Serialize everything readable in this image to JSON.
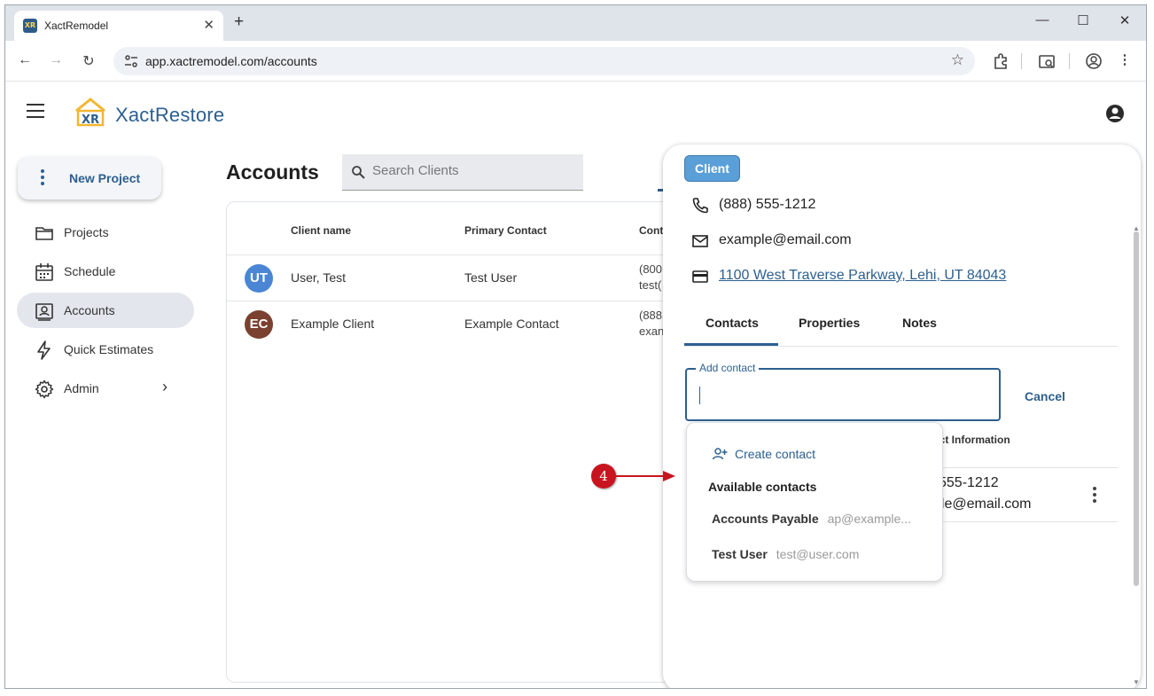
{
  "browser": {
    "tab_title": "XactRemodel",
    "favicon_text": "XR",
    "url": "app.xactremodel.com/accounts"
  },
  "header": {
    "brand": "XactRestore",
    "logo_text": "XR"
  },
  "sidebar": {
    "new_project": "New Project",
    "items": [
      {
        "label": "Projects",
        "icon": "folder-icon"
      },
      {
        "label": "Schedule",
        "icon": "calendar-icon"
      },
      {
        "label": "Accounts",
        "icon": "accounts-icon",
        "active": true
      },
      {
        "label": "Quick Estimates",
        "icon": "bolt-icon"
      },
      {
        "label": "Admin",
        "icon": "gear-icon"
      }
    ]
  },
  "main": {
    "title": "Accounts",
    "search_placeholder": "Search Clients",
    "columns": [
      "Client name",
      "Primary Contact",
      "Cont"
    ],
    "rows": [
      {
        "initials": "UT",
        "avatar_color": "#4a86d4",
        "name": "User, Test",
        "contact": "Test User",
        "info1": "(800",
        "info2": "test("
      },
      {
        "initials": "EC",
        "avatar_color": "#7a4030",
        "name": "Example Client",
        "contact": "Example Contact",
        "info1": "(888",
        "info2": "exan"
      }
    ]
  },
  "panel": {
    "chip": "Client",
    "phone": "(888) 555-1212",
    "email": "example@email.com",
    "address": "1100 West Traverse Parkway, Lehi, UT 84043",
    "tabs": [
      "Contacts",
      "Properties",
      "Notes"
    ],
    "add_contact_label": "Add contact",
    "cancel": "Cancel",
    "bg_header": "act Information",
    "bg_phone": "555-1212",
    "bg_email": "ple@email.com"
  },
  "dropdown": {
    "create": "Create contact",
    "heading": "Available contacts",
    "items": [
      {
        "name": "Accounts Payable",
        "email": "ap@example..."
      },
      {
        "name": "Test User",
        "email": "test@user.com"
      }
    ]
  },
  "callout": {
    "number": "4",
    "color": "#c8141f"
  },
  "colors": {
    "accent": "#2d5f8f",
    "chip": "#5b9fd8"
  }
}
